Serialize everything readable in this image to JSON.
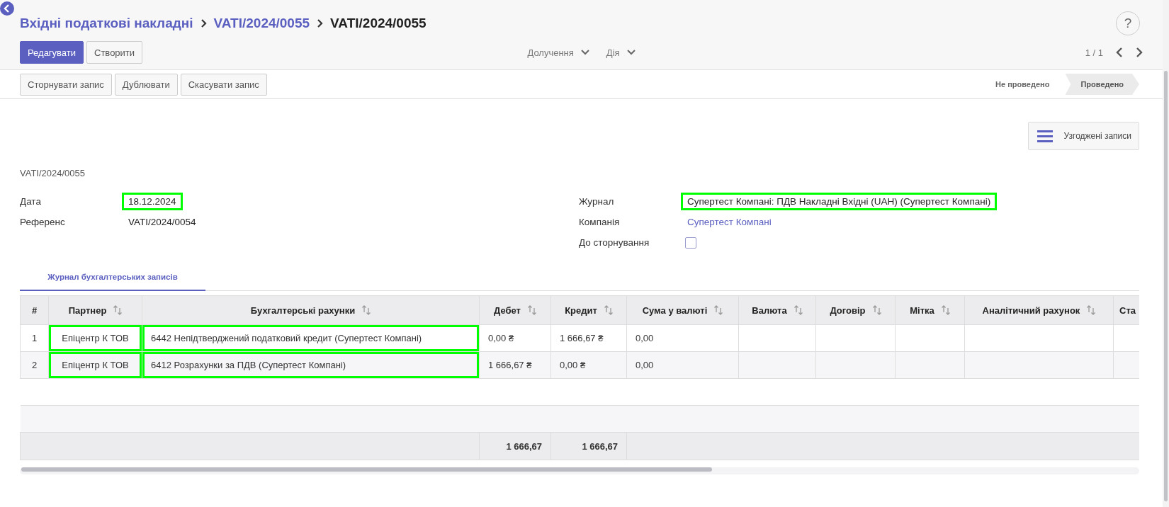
{
  "breadcrumbs": [
    {
      "label": "Вхідні податкові накладні",
      "current": false
    },
    {
      "label": "VATI/2024/0055",
      "current": false
    },
    {
      "label": "VATI/2024/0055",
      "current": true
    }
  ],
  "help": "?",
  "buttons": [
    {
      "label": "Редагувати",
      "kind": "primary"
    },
    {
      "label": "Створити",
      "kind": "secondary"
    }
  ],
  "menus": [
    "Долучення",
    "Дія"
  ],
  "pager": "1 / 1",
  "actions": [
    "Сторнувати запис",
    "Дублювати",
    "Скасувати запис"
  ],
  "stages": [
    {
      "label": "Не проведено",
      "selected": false
    },
    {
      "label": "Проведено",
      "selected": true
    }
  ],
  "smart_button": "Узгоджені записи",
  "record_name": "VATI/2024/0055",
  "left_fields": [
    {
      "label": "Дата",
      "kind": "text",
      "value": "18.12.2024",
      "highlighted": true
    },
    {
      "label": "Референс",
      "kind": "text",
      "value": "VATI/2024/0054",
      "highlighted": false
    }
  ],
  "right_fields": [
    {
      "label": "Журнал",
      "kind": "text",
      "value": "Супертест Компані: ПДВ Накладні Вхідні (UAH) (Супертест Компані)",
      "highlighted": true
    },
    {
      "label": "Компанія",
      "kind": "link",
      "value": "Супертест Компані",
      "highlighted": false
    },
    {
      "label": "До сторнування",
      "kind": "checkbox",
      "checked": false
    }
  ],
  "tabs": [
    {
      "label": "Журнал бухгалтерських записів",
      "selected": true
    }
  ],
  "table": {
    "columns": [
      {
        "label": "#",
        "sortable": false
      },
      {
        "label": "Партнер",
        "sortable": true
      },
      {
        "label": "Бухгалтерські рахунки",
        "sortable": true
      },
      {
        "label": "Дебет",
        "sortable": true
      },
      {
        "label": "Кредит",
        "sortable": true
      },
      {
        "label": "Сума у валюті",
        "sortable": true
      },
      {
        "label": "Валюта",
        "sortable": true
      },
      {
        "label": "Договір",
        "sortable": true
      },
      {
        "label": "Мітка",
        "sortable": true
      },
      {
        "label": "Аналітичний рахунок",
        "sortable": true
      },
      {
        "label": "Ста"
      }
    ],
    "rows": [
      {
        "number": "1",
        "partner": "Епіцентр К ТОВ",
        "partner_highlighted": true,
        "account": "6442 Непідтверджений податковий кредит (Супертест Компані)",
        "account_highlighted": true,
        "debit": "0,00 ₴",
        "credit": "1 666,67 ₴",
        "amount_currency": "0,00"
      },
      {
        "number": "2",
        "partner": "Епіцентр К ТОВ",
        "partner_highlighted": true,
        "account": "6412 Розрахунки за ПДВ (Супертест Компані)",
        "account_highlighted": true,
        "debit": "1 666,67 ₴",
        "credit": "0,00 ₴",
        "amount_currency": "0,00"
      }
    ],
    "totals": {
      "debit": "1 666,67",
      "credit": "1 666,67"
    }
  }
}
